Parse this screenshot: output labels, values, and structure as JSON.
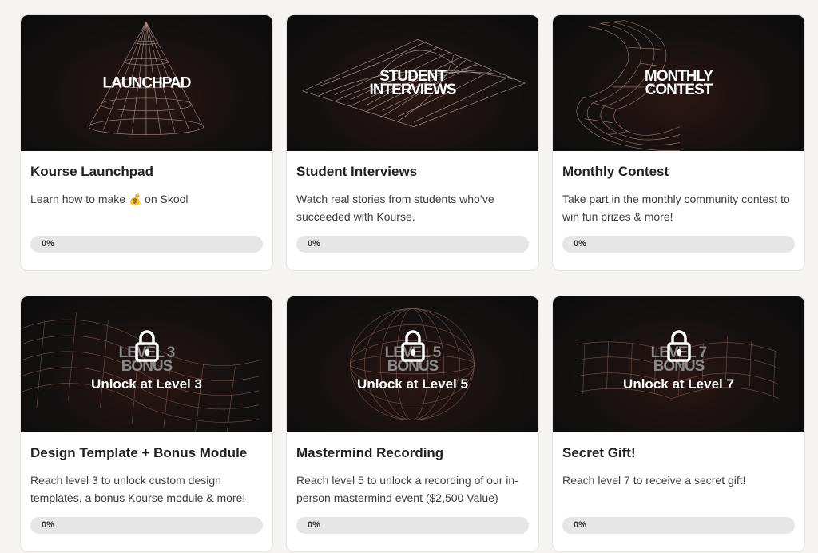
{
  "courses": [
    {
      "cover_title": "LAUNCHPAD",
      "title": "Kourse Launchpad",
      "desc_before": "Learn how to make ",
      "desc_emoji": "💰",
      "desc_after": " on Skool",
      "progress": 0,
      "progress_label": "0%",
      "locked": false
    },
    {
      "cover_title": "STUDENT\nINTERVIEWS",
      "title": "Student Interviews",
      "desc": "Watch real stories from students who’ve succeeded with Kourse.",
      "progress": 0,
      "progress_label": "0%",
      "locked": false
    },
    {
      "cover_title": "MONTHLY\nCONTEST",
      "title": "Monthly Contest",
      "desc": "Take part in the monthly community contest to win fun prizes & more!",
      "progress": 0,
      "progress_label": "0%",
      "locked": false
    },
    {
      "cover_title": "LEVEL 3\nBONUS",
      "unlock_text": "Unlock at Level 3",
      "title": "Design Template + Bonus Module",
      "desc": "Reach level 3 to unlock custom design templates, a bonus Kourse module & more!",
      "progress": 0,
      "progress_label": "0%",
      "locked": true
    },
    {
      "cover_title": "LEVEL 5\nBONUS",
      "unlock_text": "Unlock at Level 5",
      "title": "Mastermind Recording",
      "desc": "Reach level 5 to unlock a recording of our in-person mastermind event ($2,500 Value)",
      "progress": 0,
      "progress_label": "0%",
      "locked": true
    },
    {
      "cover_title": "LEVEL 7\nBONUS",
      "unlock_text": "Unlock at Level 7",
      "title": "Secret Gift!",
      "desc": "Reach level 7 to receive a secret gift!",
      "progress": 0,
      "progress_label": "0%",
      "locked": true
    }
  ],
  "icons": {
    "lock": "lock-icon",
    "money_bag": "money-bag-icon"
  },
  "colors": {
    "background": "#f5f4f2",
    "card": "#ffffff",
    "cover": "#141010",
    "wireframe": "#c9a59a",
    "progress_track": "#e6e6e6"
  }
}
